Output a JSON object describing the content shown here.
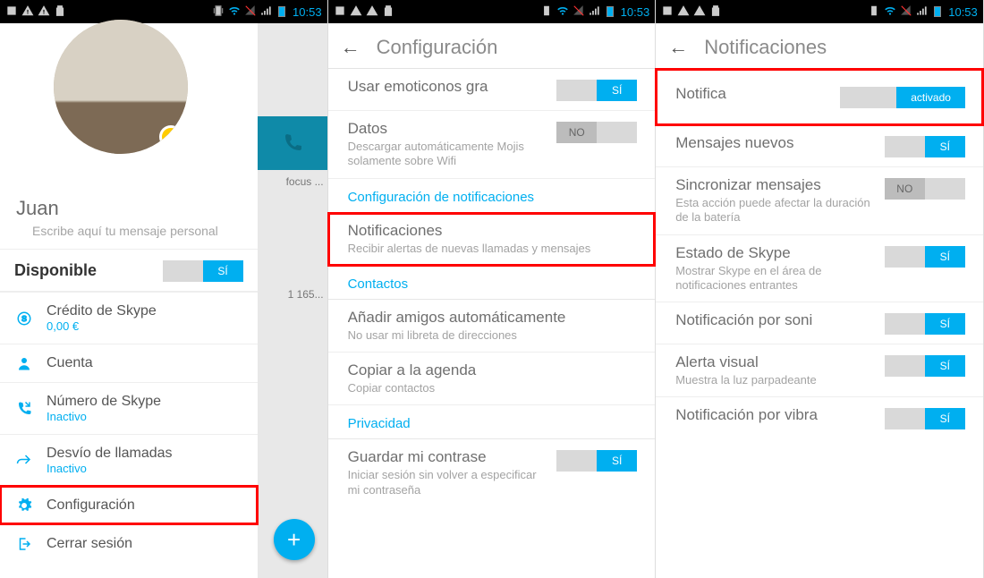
{
  "statusbar": {
    "time": "10:53"
  },
  "phone1": {
    "name": "Juan",
    "personal_msg": "Escribe aquí tu mensaje personal",
    "disponible": {
      "label": "Disponible",
      "toggle": "SÍ"
    },
    "credit": {
      "label": "Crédito de Skype",
      "value": "0,00 €"
    },
    "cuenta": "Cuenta",
    "numero": {
      "label": "Número de Skype",
      "value": "Inactivo"
    },
    "desvio": {
      "label": "Desvío de llamadas",
      "value": "Inactivo"
    },
    "config": "Configuración",
    "cerrar": "Cerrar sesión",
    "side": {
      "focus": "focus ...",
      "num": "1 165..."
    }
  },
  "phone2": {
    "header": "Configuración",
    "emoticons": {
      "label": "Usar emoticonos gra",
      "toggle": "SÍ"
    },
    "datos": {
      "label": "Datos",
      "sub": "Descargar automáticamente Mojis solamente sobre Wifi",
      "toggle": "NO"
    },
    "sec_notif": "Configuración de notificaciones",
    "notif": {
      "label": "Notificaciones",
      "sub": "Recibir alertas de nuevas llamadas y mensajes"
    },
    "sec_contactos": "Contactos",
    "amigos": {
      "label": "Añadir amigos automáticamente",
      "sub": "No usar mi libreta de direcciones"
    },
    "copiar": {
      "label": "Copiar a la agenda",
      "sub": "Copiar contactos"
    },
    "sec_priv": "Privacidad",
    "pwd": {
      "label": "Guardar mi contrase",
      "sub": "Iniciar sesión sin volver a especificar mi contraseña",
      "toggle": "SÍ"
    }
  },
  "phone3": {
    "header": "Notificaciones",
    "master": {
      "label": "Notifica",
      "toggle": "activado"
    },
    "nuevos": {
      "label": "Mensajes nuevos",
      "toggle": "SÍ"
    },
    "sync": {
      "label": "Sincronizar mensajes",
      "sub": "Esta acción puede afectar la duración de la batería",
      "toggle": "NO"
    },
    "estado": {
      "label": "Estado de Skype",
      "sub": "Mostrar Skype en el área de notificaciones entrantes",
      "toggle": "SÍ"
    },
    "sonido": {
      "label": "Notificación por soni",
      "toggle": "SÍ"
    },
    "visual": {
      "label": "Alerta visual",
      "sub": "Muestra la luz parpadeante",
      "toggle": "SÍ"
    },
    "vibra": {
      "label": "Notificación por vibra",
      "toggle": "SÍ"
    }
  }
}
